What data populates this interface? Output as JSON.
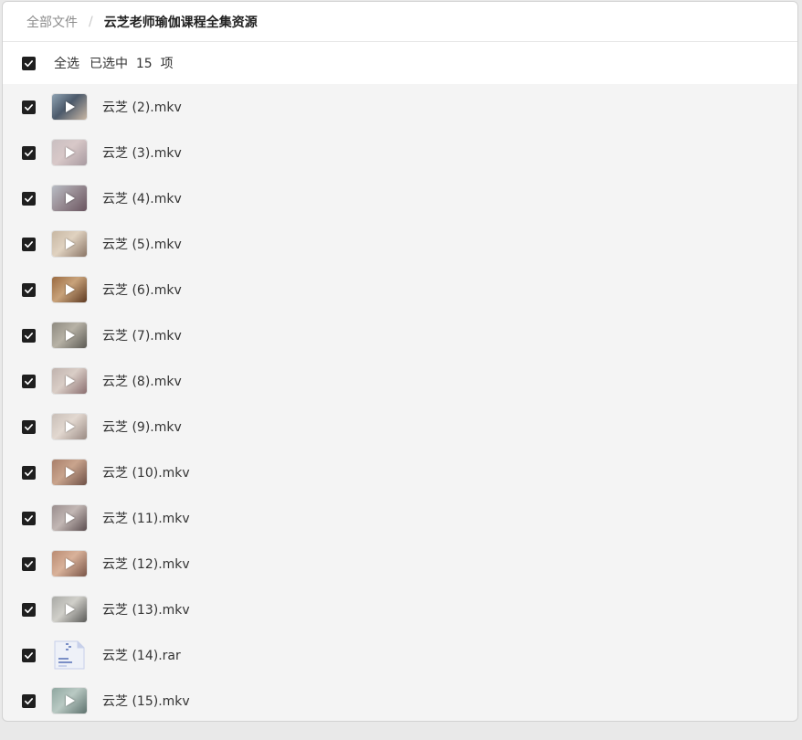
{
  "breadcrumb": {
    "root": "全部文件",
    "separator": "/",
    "current": "云芝老师瑜伽课程全集资源"
  },
  "selection": {
    "select_all_label": "全选",
    "selected_text": "已选中  15  项"
  },
  "files": [
    {
      "name": "云芝 (2).mkv",
      "type": "video",
      "thumb_colors": [
        "#8fa3b3",
        "#c9b7a5",
        "#4c5a6b"
      ]
    },
    {
      "name": "云芝 (3).mkv",
      "type": "video",
      "thumb_colors": [
        "#c9bfc1",
        "#a89aa0",
        "#d8c8c8"
      ]
    },
    {
      "name": "云芝 (4).mkv",
      "type": "video",
      "thumb_colors": [
        "#b8bcc4",
        "#6a5560",
        "#9a8f96"
      ]
    },
    {
      "name": "云芝 (5).mkv",
      "type": "video",
      "thumb_colors": [
        "#c7b7a3",
        "#8a7566",
        "#e0d2c0"
      ]
    },
    {
      "name": "云芝 (6).mkv",
      "type": "video",
      "thumb_colors": [
        "#9a6a40",
        "#5e3a22",
        "#c8a27a"
      ]
    },
    {
      "name": "云芝 (7).mkv",
      "type": "video",
      "thumb_colors": [
        "#8e8a80",
        "#5c5a54",
        "#b7b2a6"
      ]
    },
    {
      "name": "云芝 (8).mkv",
      "type": "video",
      "thumb_colors": [
        "#c0b3ae",
        "#8b6f70",
        "#d9cdc6"
      ]
    },
    {
      "name": "云芝 (9).mkv",
      "type": "video",
      "thumb_colors": [
        "#c9bfb8",
        "#9a8b84",
        "#e2d8d0"
      ]
    },
    {
      "name": "云芝 (10).mkv",
      "type": "video",
      "thumb_colors": [
        "#a87f6a",
        "#6e5046",
        "#c9a48d"
      ]
    },
    {
      "name": "云芝 (11).mkv",
      "type": "video",
      "thumb_colors": [
        "#9a8e8e",
        "#5c4e50",
        "#c2b7b4"
      ]
    },
    {
      "name": "云芝 (12).mkv",
      "type": "video",
      "thumb_colors": [
        "#b98b72",
        "#7a5548",
        "#d9b29a"
      ]
    },
    {
      "name": "云芝 (13).mkv",
      "type": "video",
      "thumb_colors": [
        "#a9aaa6",
        "#5a5a58",
        "#d0cfc9"
      ]
    },
    {
      "name": "云芝 (14).rar",
      "type": "archive",
      "thumb_colors": [
        "#eef1f8",
        "#7b8fc6",
        "#c7d0ea"
      ]
    },
    {
      "name": "云芝 (15).mkv",
      "type": "video",
      "thumb_colors": [
        "#8fa7a0",
        "#5e726e",
        "#b9c9c3"
      ]
    }
  ],
  "colors": {
    "checkbox": "#1f1f1f",
    "window_bg": "#f4f4f4",
    "header_bg": "#ffffff"
  }
}
